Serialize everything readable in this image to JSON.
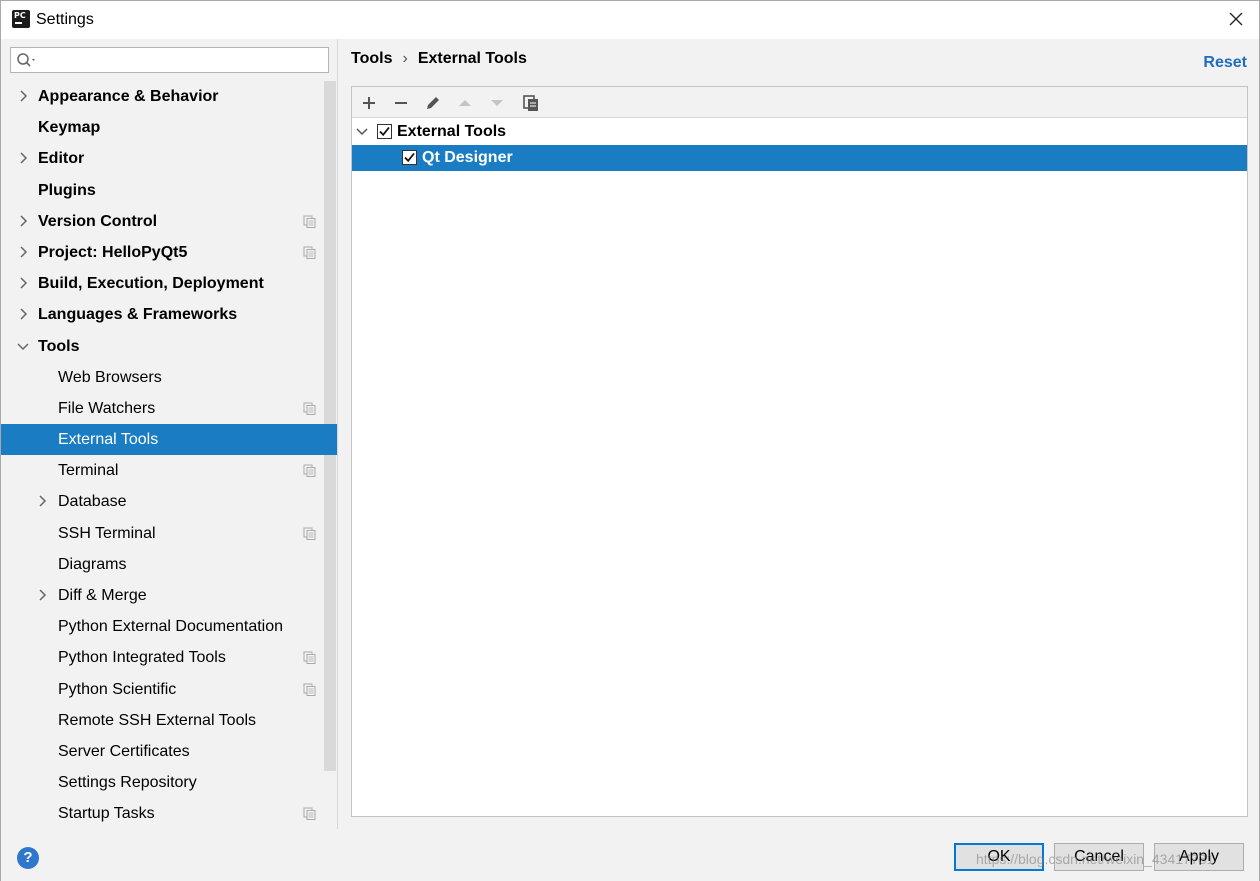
{
  "window": {
    "title": "Settings",
    "app_icon_text": "PC"
  },
  "search": {
    "placeholder": "",
    "value": ""
  },
  "sidebar": {
    "items": [
      {
        "label": "Appearance & Behavior",
        "level": 0,
        "expandable": true,
        "expanded": false,
        "project": false
      },
      {
        "label": "Keymap",
        "level": 0,
        "expandable": false,
        "project": false
      },
      {
        "label": "Editor",
        "level": 0,
        "expandable": true,
        "expanded": false,
        "project": false
      },
      {
        "label": "Plugins",
        "level": 0,
        "expandable": false,
        "project": false
      },
      {
        "label": "Version Control",
        "level": 0,
        "expandable": true,
        "expanded": false,
        "project": true
      },
      {
        "label": "Project: HelloPyQt5",
        "level": 0,
        "expandable": true,
        "expanded": false,
        "project": true
      },
      {
        "label": "Build, Execution, Deployment",
        "level": 0,
        "expandable": true,
        "expanded": false,
        "project": false
      },
      {
        "label": "Languages & Frameworks",
        "level": 0,
        "expandable": true,
        "expanded": false,
        "project": false
      },
      {
        "label": "Tools",
        "level": 0,
        "expandable": true,
        "expanded": true,
        "project": false
      },
      {
        "label": "Web Browsers",
        "level": 1,
        "expandable": false,
        "project": false
      },
      {
        "label": "File Watchers",
        "level": 1,
        "expandable": false,
        "project": true
      },
      {
        "label": "External Tools",
        "level": 1,
        "expandable": false,
        "project": false,
        "selected": true
      },
      {
        "label": "Terminal",
        "level": 1,
        "expandable": false,
        "project": true
      },
      {
        "label": "Database",
        "level": 1,
        "expandable": true,
        "expanded": false,
        "project": false
      },
      {
        "label": "SSH Terminal",
        "level": 1,
        "expandable": false,
        "project": true
      },
      {
        "label": "Diagrams",
        "level": 1,
        "expandable": false,
        "project": false
      },
      {
        "label": "Diff & Merge",
        "level": 1,
        "expandable": true,
        "expanded": false,
        "project": false
      },
      {
        "label": "Python External Documentation",
        "level": 1,
        "expandable": false,
        "project": false
      },
      {
        "label": "Python Integrated Tools",
        "level": 1,
        "expandable": false,
        "project": true
      },
      {
        "label": "Python Scientific",
        "level": 1,
        "expandable": false,
        "project": true
      },
      {
        "label": "Remote SSH External Tools",
        "level": 1,
        "expandable": false,
        "project": false
      },
      {
        "label": "Server Certificates",
        "level": 1,
        "expandable": false,
        "project": false
      },
      {
        "label": "Settings Repository",
        "level": 1,
        "expandable": false,
        "project": false
      },
      {
        "label": "Startup Tasks",
        "level": 1,
        "expandable": false,
        "project": true
      }
    ]
  },
  "breadcrumb": {
    "parent": "Tools",
    "separator": "›",
    "current": "External Tools"
  },
  "reset_label": "Reset",
  "toolbar": {
    "add_icon": "plus-icon",
    "remove_icon": "minus-icon",
    "edit_icon": "pencil-icon",
    "move_up_icon": "arrow-up-icon",
    "move_down_icon": "arrow-down-icon",
    "copy_icon": "copy-icon"
  },
  "tool_tree": {
    "group": {
      "label": "External Tools",
      "checked": true,
      "expanded": true
    },
    "items": [
      {
        "label": "Qt Designer",
        "checked": true,
        "selected": true
      }
    ]
  },
  "buttons": {
    "help": "?",
    "ok": "OK",
    "cancel": "Cancel",
    "apply": "Apply"
  },
  "watermark": "https://blog.csdn.net/weixin_43417731",
  "colors": {
    "selection": "#1a7dc4",
    "link": "#1f6dbf",
    "ok_border": "#0078d7",
    "help": "#2f76cd"
  }
}
